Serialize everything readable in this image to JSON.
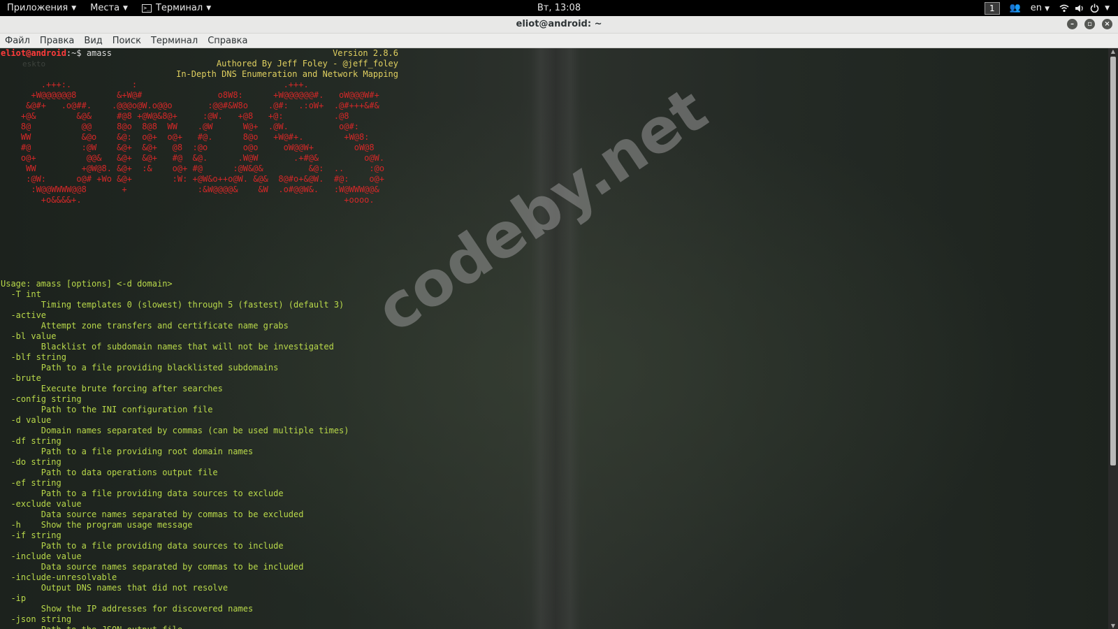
{
  "panel": {
    "apps": "Приложения",
    "places": "Места",
    "terminal": "Терминал",
    "clock": "Вт, 13:08",
    "workspace": "1",
    "lang": "en",
    "icons": [
      "people-icon",
      "wifi-icon",
      "volume-icon",
      "power-icon"
    ]
  },
  "window": {
    "title": "eliot@android: ~",
    "menu": [
      "Файл",
      "Правка",
      "Вид",
      "Поиск",
      "Терминал",
      "Справка"
    ]
  },
  "terminal": {
    "prompt_user": "eliot@android",
    "prompt_rest": ":~$ amass",
    "ghost_text": "eskto",
    "banner": "        .+++:.            :                             .+++.\n      +W@@@@@@8        &+W@#               o8W8:      +W@@@@@@#.   oW@@@W#+\n     &@#+   .o@##.    .@@@o@W.o@@o       :@@#&W8o    .@#:  .:oW+  .@#+++&#&\n    +@&        &@&     #@8 +@W@&8@+     :@W.   +@8   +@:          .@8\n    8@          @@     8@o  8@8  WW    .@W      W@+  .@W.          o@#:\n    WW          &@o    &@:  o@+  o@+   #@.      8@o   +W@#+.        +W@8:\n    #@          :@W    &@+  &@+   @8  :@o       o@o     oW@@W+        oW@8\n    o@+          @@&   &@+  &@+   #@  &@.      .W@W       .+#@&         o@W.\n     WW         +@W@8. &@+  :&    o@+ #@      :@W&@&         &@:  ..     :@o\n     :@W:      o@# +Wo &@+        :W: +@W&o++o@W. &@&  8@#o+&@W.  #@:    o@+\n      :W@@WWWW@@8       +              :&W@@@@&    &W  .o#@@W&.   :W@WWW@@&\n        +o&&&&+.                                                    +oooo.",
    "version": "Version 2.8.6",
    "author": "Authored By Jeff Foley - @jeff_foley",
    "tagline": "In-Depth DNS Enumeration and Network Mapping",
    "usage": "Usage: amass [options] <-d domain>\n  -T int\n        Timing templates 0 (slowest) through 5 (fastest) (default 3)\n  -active\n        Attempt zone transfers and certificate name grabs\n  -bl value\n        Blacklist of subdomain names that will not be investigated\n  -blf string\n        Path to a file providing blacklisted subdomains\n  -brute\n        Execute brute forcing after searches\n  -config string\n        Path to the INI configuration file\n  -d value\n        Domain names separated by commas (can be used multiple times)\n  -df string\n        Path to a file providing root domain names\n  -do string\n        Path to data operations output file\n  -ef string\n        Path to a file providing data sources to exclude\n  -exclude value\n        Data source names separated by commas to be excluded\n  -h    Show the program usage message\n  -if string\n        Path to a file providing data sources to include\n  -include value\n        Data source names separated by commas to be included\n  -include-unresolvable\n        Output DNS names that did not resolve\n  -ip\n        Show the IP addresses for discovered names\n  -json string\n        Path to the JSON output file"
  },
  "watermark": "codeby.net"
}
